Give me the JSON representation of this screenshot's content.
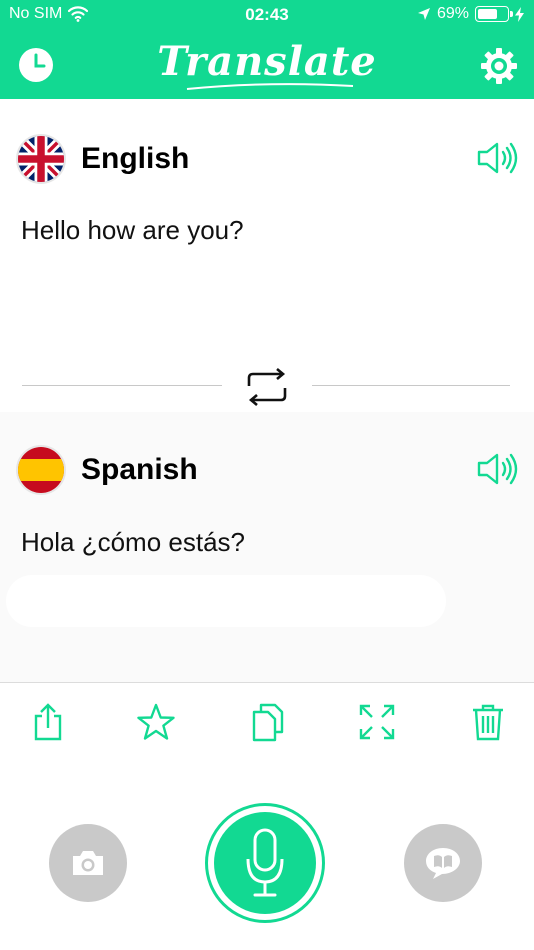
{
  "colors": {
    "accent": "#12d992",
    "button_gray": "#c9c9c9",
    "text": "#111111",
    "divider": "#c8c8c8"
  },
  "status_bar": {
    "carrier": "No SIM",
    "time": "02:43",
    "battery_percent": "69%",
    "battery_level": 0.69
  },
  "header": {
    "title": "Translate",
    "history_icon": "clock-icon",
    "settings_icon": "gear-icon"
  },
  "source": {
    "language": "English",
    "flag": "uk-flag",
    "text": "Hello how are you?",
    "speak_icon": "speaker-icon"
  },
  "target": {
    "language": "Spanish",
    "flag": "spain-flag",
    "text": "Hola ¿cómo estás?",
    "speak_icon": "speaker-icon"
  },
  "swap_icon": "swap-icon",
  "toolbar": {
    "icons": [
      "share-icon",
      "star-icon",
      "copy-icon",
      "fullscreen-icon",
      "trash-icon"
    ]
  },
  "bottom": {
    "camera_icon": "camera-icon",
    "mic_icon": "microphone-icon",
    "conversation_icon": "conversation-icon"
  }
}
